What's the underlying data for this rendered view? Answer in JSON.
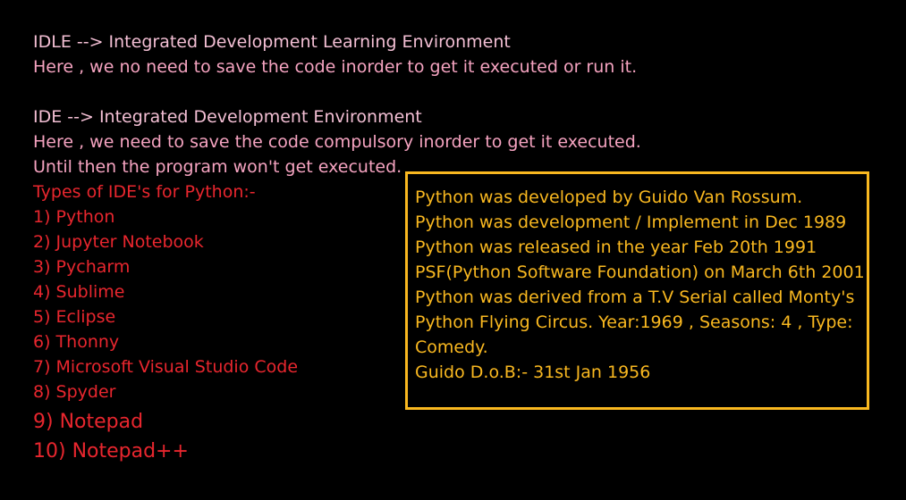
{
  "idle": {
    "title": "IDLE --> Integrated Development Learning Environment",
    "desc": "Here , we no need to save the code inorder to get it executed or run it."
  },
  "ide": {
    "title": "IDE --> Integrated Development Environment",
    "desc1": "Here , we need to save the code compulsory inorder to get it executed.",
    "desc2": "Until then the program won't get executed."
  },
  "types": {
    "heading": "Types of IDE's for Python:-",
    "items": [
      "1) Python",
      "2) Jupyter Notebook",
      "3) Pycharm",
      "4) Sublime",
      "5) Eclipse",
      "6) Thonny",
      "7) Microsoft Visual Studio Code",
      "8) Spyder",
      "9) Notepad",
      "10) Notepad++"
    ]
  },
  "info": {
    "lines": [
      "Python was developed by Guido Van Rossum.",
      "Python was development / Implement in Dec 1989",
      "Python was released in the year Feb 20th 1991",
      "PSF(Python Software Foundation) on March 6th 2001",
      "Python was derived from a T.V Serial called Monty's",
      "Python Flying Circus. Year:1969  , Seasons: 4 , Type:",
      "Comedy.",
      "Guido D.o.B:- 31st Jan 1956"
    ]
  },
  "colors": {
    "background": "#000000",
    "pink_text": "#f3bfd4",
    "red_text": "#e8262e",
    "box_accent": "#f9b820"
  }
}
